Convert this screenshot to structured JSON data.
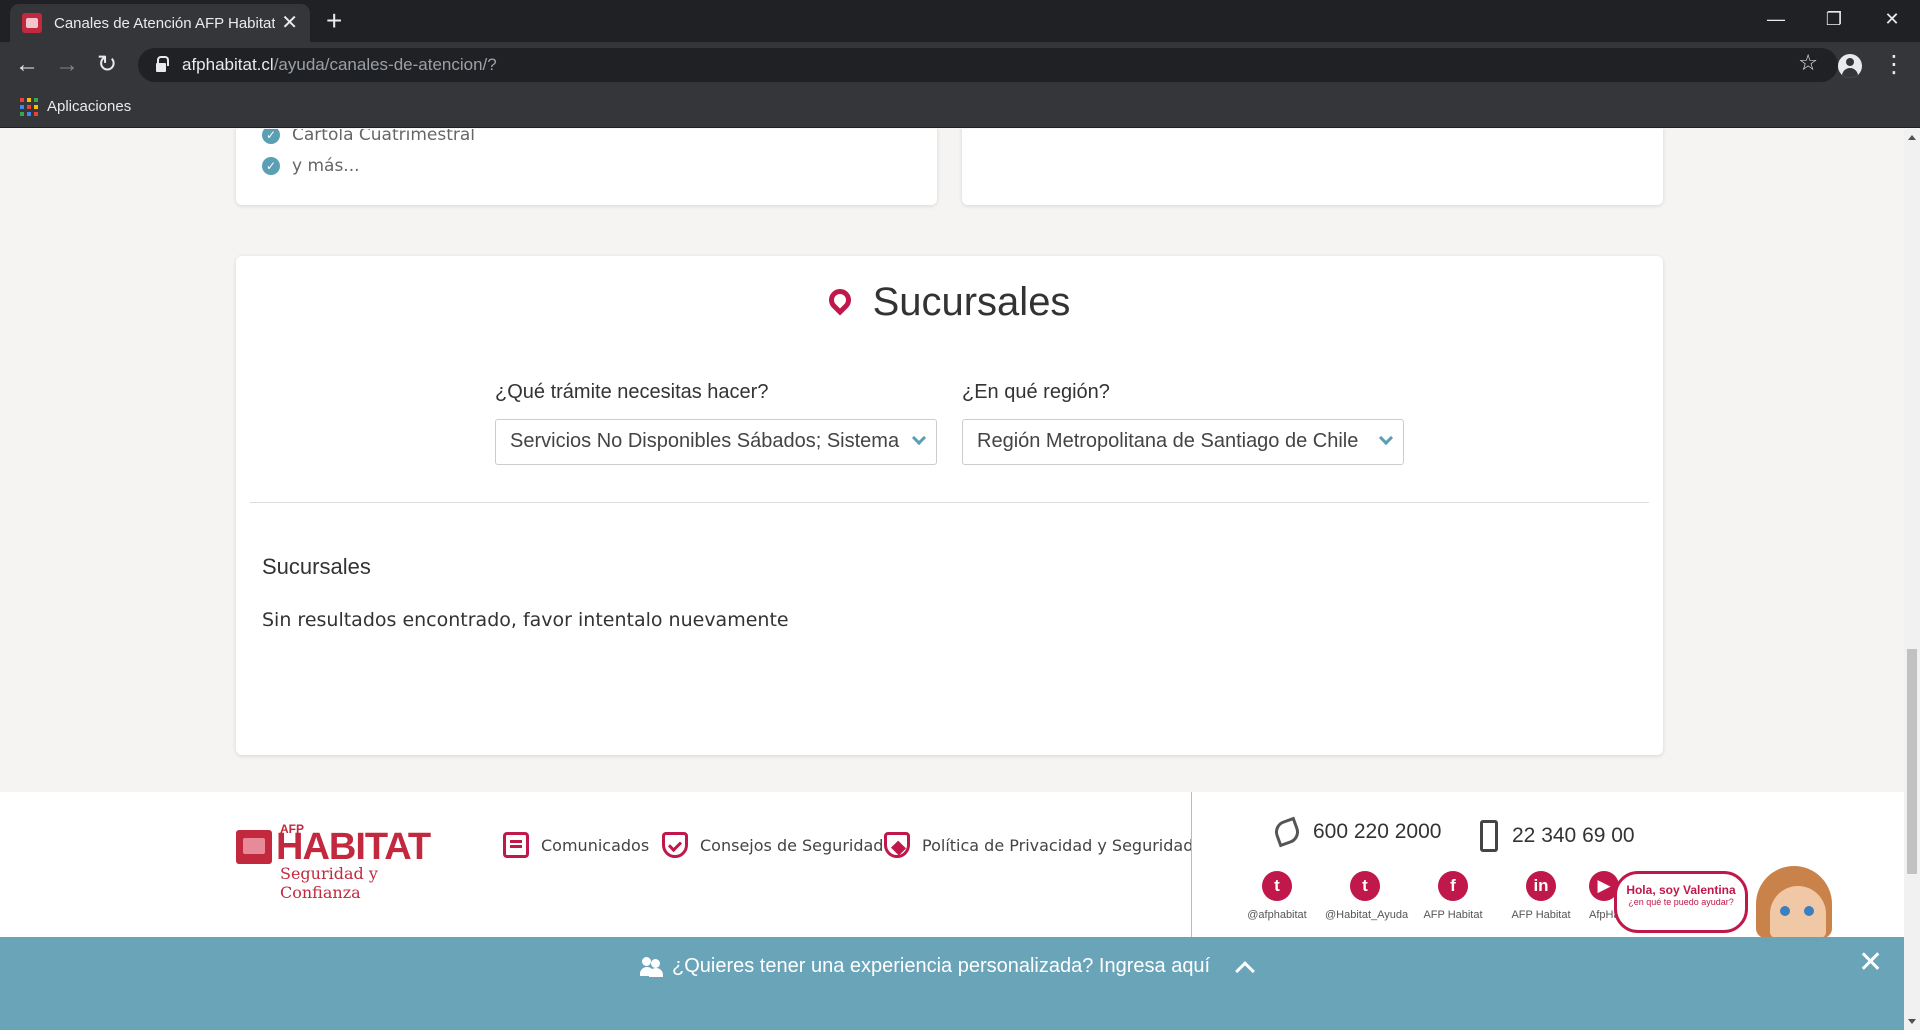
{
  "browser": {
    "tab_title": "Canales de Atención AFP Habitat",
    "url_host": "afphabitat.cl",
    "url_path": "/ayuda/canales-de-atencion/?",
    "bookmarks_label": "Aplicaciones"
  },
  "card_left": {
    "items": [
      "Cartola Cuatrimestral",
      "y más..."
    ]
  },
  "sucursales": {
    "title": "Sucursales",
    "tramite_label": "¿Qué trámite necesitas hacer?",
    "tramite_value": "Servicios No Disponibles Sábados; Sistema",
    "region_label": "¿En qué región?",
    "region_value": "Región Metropolitana de Santiago de Chile",
    "results_title": "Sucursales",
    "results_message": "Sin resultados encontrado, favor intentalo nuevamente"
  },
  "footer": {
    "logo_afp": "AFP",
    "logo_name": "HABITAT",
    "logo_tagline": "Seguridad y Confianza",
    "links": [
      "Comunicados",
      "Consejos de Seguridad",
      "Política de Privacidad y Seguridad"
    ],
    "phone_landline": "600 220 2000",
    "phone_mobile": "22 340 69 00",
    "social": [
      {
        "label": "@afphabitat",
        "glyph": "t"
      },
      {
        "label": "@Habitat_Ayuda",
        "glyph": "t"
      },
      {
        "label": "AFP Habitat",
        "glyph": "f"
      },
      {
        "label": "AFP Habitat",
        "glyph": "in"
      },
      {
        "label": "AfpHa",
        "glyph": "▶"
      }
    ]
  },
  "chat": {
    "line1": "Hola, soy Valentina",
    "line2": "¿en qué te puedo ayudar?"
  },
  "promo": {
    "text": "¿Quieres tener una experiencia personalizada? Ingresa aquí"
  },
  "colors": {
    "brand": "#c0184a",
    "accent": "#5b9fb5",
    "promo_bar": "#6aa4b8"
  }
}
